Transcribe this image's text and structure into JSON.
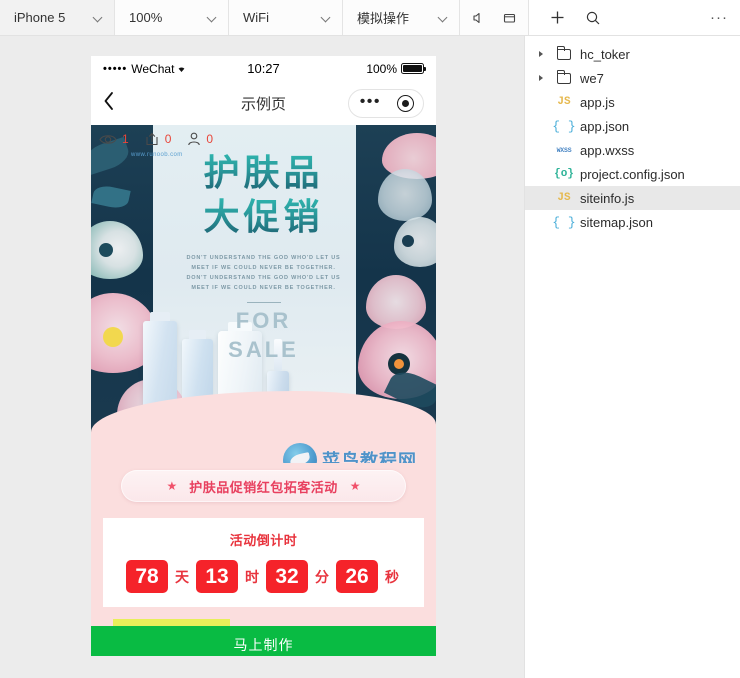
{
  "toolbar": {
    "device": "iPhone 5",
    "zoom": "100%",
    "network": "WiFi",
    "simulate": "模拟操作",
    "mute_icon": "speaker-icon",
    "window_icon": "window-icon",
    "add_icon": "plus-icon",
    "search_icon": "search-icon",
    "overflow": "···"
  },
  "file_tree": [
    {
      "name": "hc_toker",
      "type": "folder",
      "expandable": true,
      "selected": false,
      "icon": "folder-icon"
    },
    {
      "name": "we7",
      "type": "folder",
      "expandable": true,
      "selected": false,
      "icon": "folder-icon"
    },
    {
      "name": "app.js",
      "type": "js",
      "expandable": false,
      "selected": false,
      "icon": "js-icon",
      "badge": "JS"
    },
    {
      "name": "app.json",
      "type": "json",
      "expandable": false,
      "selected": false,
      "icon": "json-icon",
      "badge": "{ }"
    },
    {
      "name": "app.wxss",
      "type": "wxss",
      "expandable": false,
      "selected": false,
      "icon": "wxss-icon",
      "badge": "WXSS"
    },
    {
      "name": "project.config.json",
      "type": "cfg",
      "expandable": false,
      "selected": false,
      "icon": "config-icon",
      "badge": "{o}"
    },
    {
      "name": "siteinfo.js",
      "type": "js",
      "expandable": false,
      "selected": true,
      "icon": "js-icon",
      "badge": "JS"
    },
    {
      "name": "sitemap.json",
      "type": "json",
      "expandable": false,
      "selected": false,
      "icon": "json-icon",
      "badge": "{ }"
    }
  ],
  "phone": {
    "status": {
      "signal_dots": "•••••",
      "carrier": "WeChat",
      "wifi_icon": "wifi-icon",
      "time": "10:27",
      "battery_pct": "100%",
      "battery_icon": "battery-icon"
    },
    "nav": {
      "back_icon": "chevron-left-icon",
      "title": "示例页",
      "more_icon": "more-dots-icon",
      "target_icon": "target-icon"
    },
    "stats": [
      {
        "icon": "eye-icon",
        "value": "1"
      },
      {
        "icon": "share-icon",
        "value": "0"
      },
      {
        "icon": "person-icon",
        "value": "0"
      }
    ],
    "poster": {
      "headline_1": "护肤品",
      "headline_2": "大促销",
      "sub_1": "DON'T UNDERSTAND THE GOD WHO'D LET US",
      "sub_2": "MEET IF WE COULD NEVER BE TOGETHER.",
      "sub_3": "DON'T UNDERSTAND THE GOD WHO'D LET US",
      "sub_4": "MEET IF WE COULD NEVER BE TOGETHER.",
      "for_sale_1": "FOR",
      "for_sale_2": "SALE",
      "watermark_text": "菜鸟教程网",
      "watermark_url": "www.runoob.com",
      "watermark_logo": "bird-logo-icon"
    },
    "cta": {
      "star_left": "★",
      "label": "护肤品促销红包拓客活动",
      "star_right": "★"
    },
    "countdown": {
      "title": "活动倒计时",
      "items": [
        {
          "value": "78",
          "unit": "天"
        },
        {
          "value": "13",
          "unit": "时"
        },
        {
          "value": "32",
          "unit": "分"
        },
        {
          "value": "26",
          "unit": "秒"
        }
      ]
    },
    "action_button": "马上制作"
  },
  "colors": {
    "accent_red": "#f5232a",
    "accent_pink": "#fbdede",
    "wechat_green": "#09bb43",
    "teal": "#2a9a9c",
    "yellow": "#e8ef5a"
  }
}
